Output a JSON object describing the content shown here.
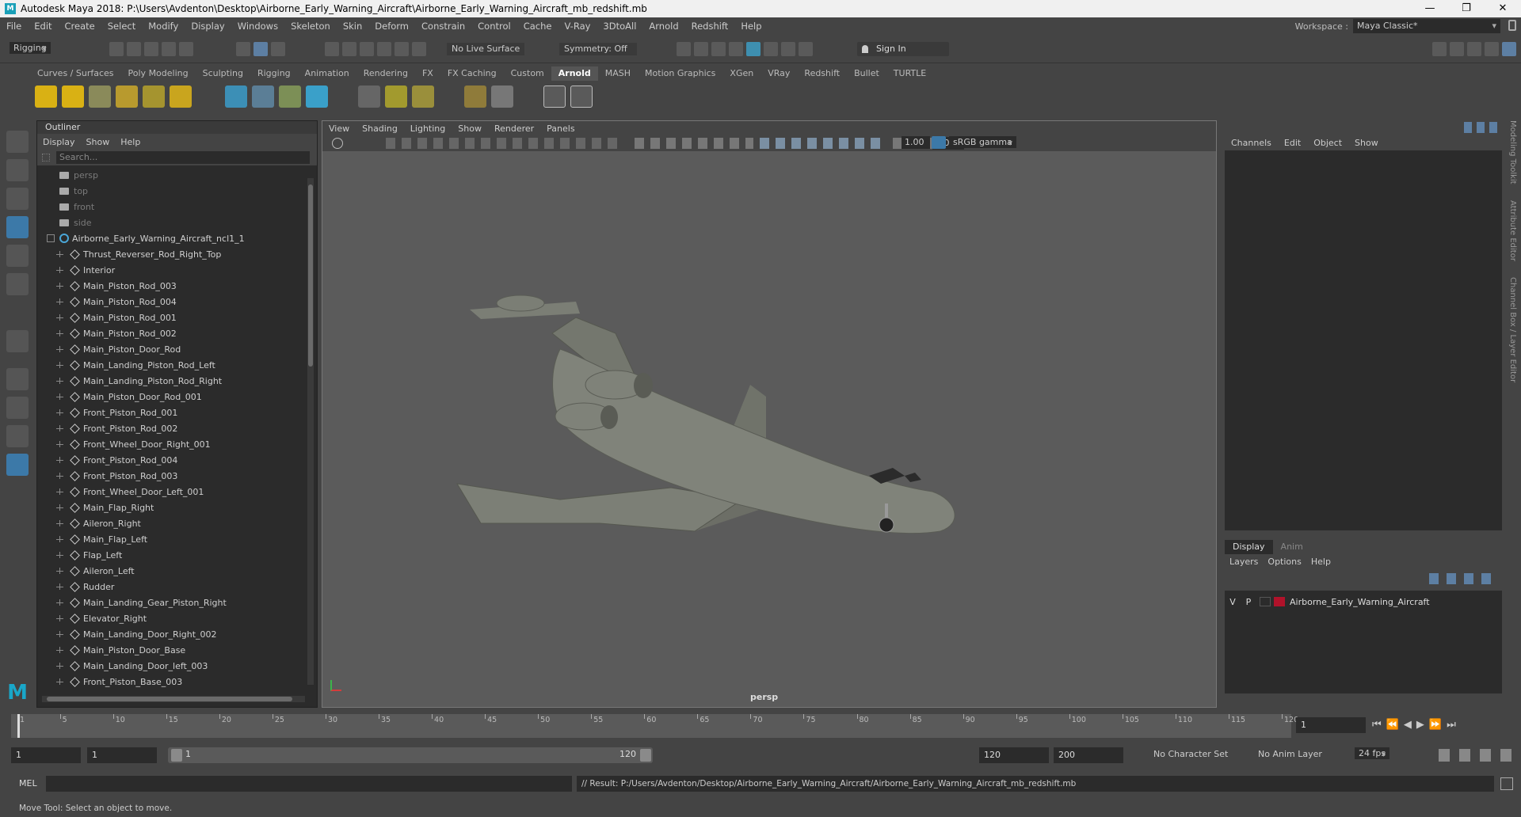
{
  "window": {
    "title": "Autodesk Maya 2018: P:\\Users\\Avdenton\\Desktop\\Airborne_Early_Warning_Aircraft\\Airborne_Early_Warning_Aircraft_mb_redshift.mb",
    "minimize": "—",
    "maximize": "❐",
    "close": "✕"
  },
  "menubar": {
    "items": [
      "File",
      "Edit",
      "Create",
      "Select",
      "Modify",
      "Display",
      "Windows",
      "Skeleton",
      "Skin",
      "Deform",
      "Constrain",
      "Control",
      "Cache",
      "V-Ray",
      "3DtoAll",
      "Arnold",
      "Redshift",
      "Help"
    ],
    "workspace_label": "Workspace :",
    "workspace_value": "Maya Classic*"
  },
  "statusline": {
    "menuset": "Rigging",
    "live_surface": "No Live Surface",
    "symmetry": "Symmetry: Off",
    "sign_in": "Sign In"
  },
  "shelf": {
    "tabs": [
      "Curves / Surfaces",
      "Poly Modeling",
      "Sculpting",
      "Rigging",
      "Animation",
      "Rendering",
      "FX",
      "FX Caching",
      "Custom",
      "Arnold",
      "MASH",
      "Motion Graphics",
      "XGen",
      "VRay",
      "Redshift",
      "Bullet",
      "TURTLE"
    ],
    "active_tab": "Arnold"
  },
  "outliner": {
    "title": "Outliner",
    "menu": [
      "Display",
      "Show",
      "Help"
    ],
    "search_placeholder": "Search...",
    "cameras": [
      "persp",
      "top",
      "front",
      "side"
    ],
    "root": "Airborne_Early_Warning_Aircraft_ncl1_1",
    "children": [
      "Thrust_Reverser_Rod_Right_Top",
      "Interior",
      "Main_Piston_Rod_003",
      "Main_Piston_Rod_004",
      "Main_Piston_Rod_001",
      "Main_Piston_Rod_002",
      "Main_Piston_Door_Rod",
      "Main_Landing_Piston_Rod_Left",
      "Main_Landing_Piston_Rod_Right",
      "Main_Piston_Door_Rod_001",
      "Front_Piston_Rod_001",
      "Front_Piston_Rod_002",
      "Front_Wheel_Door_Right_001",
      "Front_Piston_Rod_004",
      "Front_Piston_Rod_003",
      "Front_Wheel_Door_Left_001",
      "Main_Flap_Right",
      "Aileron_Right",
      "Main_Flap_Left",
      "Flap_Left",
      "Aileron_Left",
      "Rudder",
      "Main_Landing_Gear_Piston_Right",
      "Elevator_Right",
      "Main_Landing_Door_Right_002",
      "Main_Piston_Door_Base",
      "Main_Landing_Door_left_003",
      "Front_Piston_Base_003"
    ]
  },
  "viewport": {
    "menu": [
      "View",
      "Shading",
      "Lighting",
      "Show",
      "Renderer",
      "Panels"
    ],
    "exposure": "0.00",
    "gamma": "1.00",
    "color_space": "sRGB gamma",
    "camera_label": "persp"
  },
  "channelbox": {
    "menu": [
      "Channels",
      "Edit",
      "Object",
      "Show"
    ]
  },
  "layers": {
    "tabs": [
      "Display",
      "Anim"
    ],
    "menu": [
      "Layers",
      "Options",
      "Help"
    ],
    "layer": {
      "v": "V",
      "p": "P",
      "name": "Airborne_Early_Warning_Aircraft",
      "color": "#b0122a"
    }
  },
  "sidetabs": [
    "Modeling Toolkit",
    "Attribute Editor",
    "Channel Box / Layer Editor"
  ],
  "timeline": {
    "ticks": [
      "1",
      "5",
      "10",
      "15",
      "20",
      "25",
      "30",
      "35",
      "40",
      "45",
      "50",
      "55",
      "60",
      "65",
      "70",
      "75",
      "80",
      "85",
      "90",
      "95",
      "100",
      "105",
      "110",
      "115",
      "120"
    ],
    "current_frame": "1"
  },
  "range": {
    "start": "1",
    "playback_start": "1",
    "slider_start": "1",
    "slider_end": "120",
    "playback_end": "120",
    "end": "200",
    "character_set": "No Character Set",
    "anim_layer": "No Anim Layer",
    "fps": "24 fps"
  },
  "mel": {
    "label": "MEL",
    "result": "// Result: P:/Users/Avdenton/Desktop/Airborne_Early_Warning_Aircraft/Airborne_Early_Warning_Aircraft_mb_redshift.mb"
  },
  "helpline": "Move Tool: Select an object to move."
}
